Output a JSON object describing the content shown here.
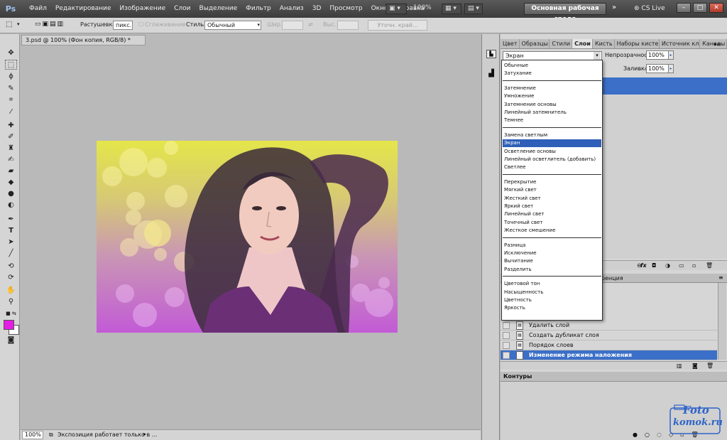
{
  "app": {
    "logo": "Ps",
    "menu": [
      "Файл",
      "Редактирование",
      "Изображение",
      "Слои",
      "Выделение",
      "Фильтр",
      "Анализ",
      "3D",
      "Просмотр",
      "Окно",
      "Справка"
    ],
    "zoom_value": "100%",
    "workspace": "Основная рабочая среда",
    "cs_live": "CS Live"
  },
  "options": {
    "feather_label": "Растушевка:",
    "feather_value": "пикс.",
    "antialias_label": "Сглаживание",
    "style_label": "Стиль:",
    "style_value": "Обычный",
    "width_label": "Шир.:",
    "height_label": "Выс.:",
    "refine_edge": "Уточн. край..."
  },
  "document": {
    "tab_title": "3.psd @ 100% (Фон копия, RGB/8) *",
    "zoom": "100%",
    "status_text": "Экспозиция работает только в ..."
  },
  "colors": {
    "foreground": "#e41ee4",
    "background": "#ffffff",
    "selection": "#3b6fc8"
  },
  "panel": {
    "tabs": [
      "Цвет",
      "Образцы",
      "Стили",
      "Слои",
      "Кисть",
      "Наборы кисте",
      "Источник кл",
      "Каналы"
    ],
    "active_tab": "Слои",
    "blend_mode": "Экран",
    "opacity_label": "Непрозрачность:",
    "opacity_value": "100%",
    "fill_label": "Заливка:",
    "fill_value": "100%",
    "history_tab_end": "ренция",
    "contours_title": "Контуры"
  },
  "blend_groups": [
    [
      "Обычные",
      "Затухание"
    ],
    [
      "Затемнение",
      "Умножение",
      "Затемнение основы",
      "Линейный затемнитель",
      "Темнее"
    ],
    [
      "Замена светлым",
      "Экран",
      "Осветление основы",
      "Линейный осветлитель (добавить)",
      "Светлее"
    ],
    [
      "Перекрытие",
      "Мягкий свет",
      "Жесткий свет",
      "Яркий свет",
      "Линейный свет",
      "Точечный свет",
      "Жесткое смешение"
    ],
    [
      "Разница",
      "Исключение",
      "Вычитание",
      "Разделить"
    ],
    [
      "Цветовой тон",
      "Насыщенность",
      "Цветность",
      "Яркость"
    ]
  ],
  "blend_selected": "Экран",
  "history": [
    {
      "label": "Удалить слой",
      "selected": false
    },
    {
      "label": "Создать дубликат слоя",
      "selected": false
    },
    {
      "label": "Порядок слоев",
      "selected": false
    },
    {
      "label": "Изменение режима наложения",
      "selected": true
    }
  ],
  "watermark": {
    "line1": "Foto",
    "line2": "komok.ru"
  }
}
